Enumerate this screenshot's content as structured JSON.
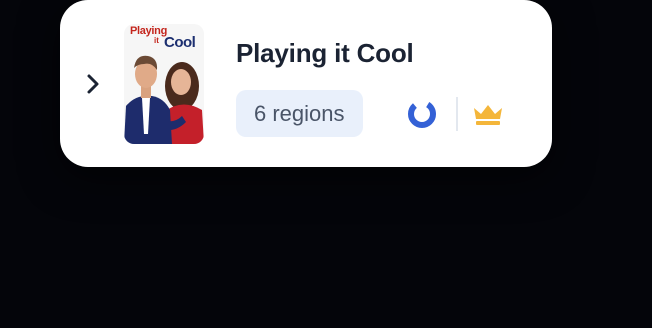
{
  "item": {
    "title": "Playing it Cool",
    "regions_label": "6 regions",
    "poster": {
      "title_line1": "Playing",
      "title_it": "it",
      "title_line2": "Cool"
    }
  },
  "icons": {
    "expand": "chevron-right-icon",
    "provider": "ring-logo-icon",
    "premium": "crown-icon"
  },
  "colors": {
    "card_bg": "#ffffff",
    "page_bg": "#04050a",
    "title": "#1b2333",
    "badge_bg": "#e9f0fb",
    "badge_text": "#4a5568",
    "ring_blue": "#3461d6",
    "crown_gold": "#f4b63a"
  }
}
